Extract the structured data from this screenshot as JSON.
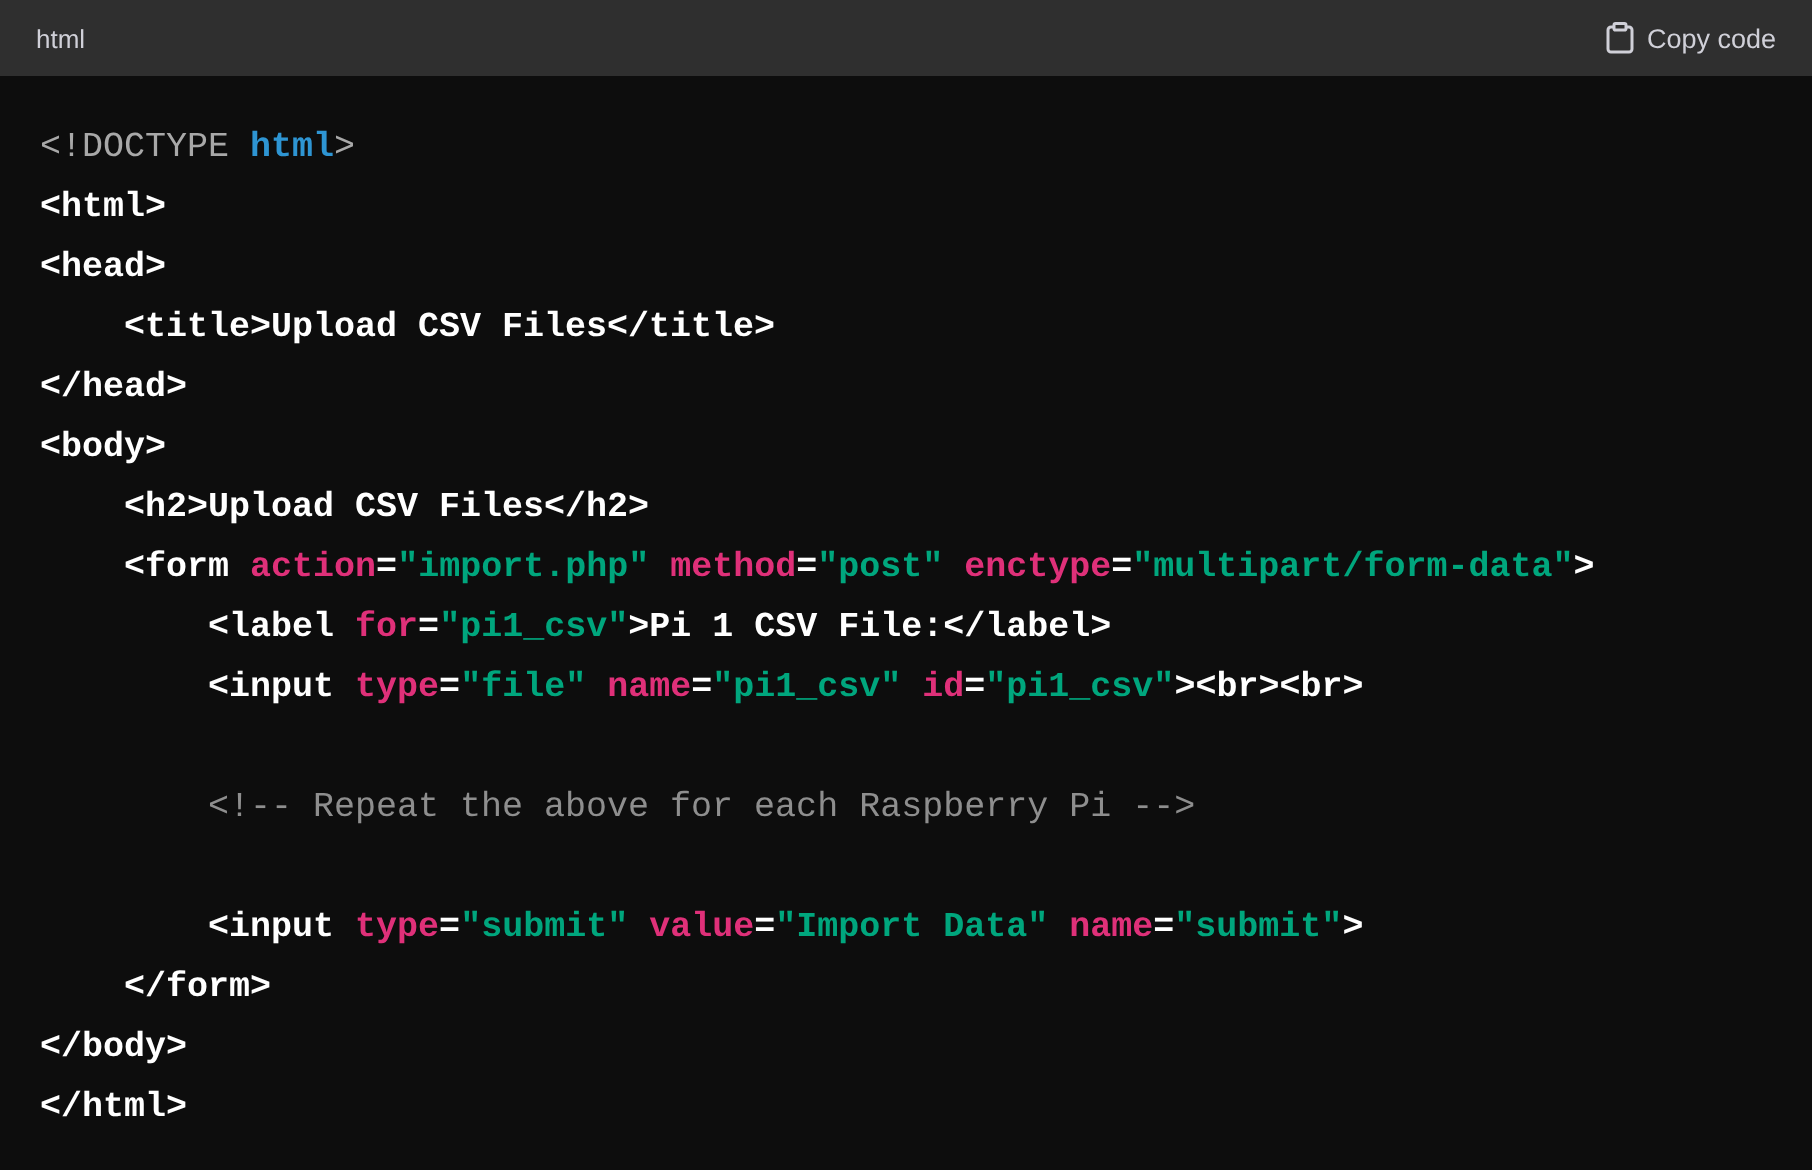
{
  "header": {
    "language": "html",
    "copy_label": "Copy code"
  },
  "lines": [
    {
      "kind": "code",
      "tokens": [
        {
          "kind": "meta",
          "text": "<!DOCTYPE "
        },
        {
          "kind": "keyword",
          "text": "html"
        },
        {
          "kind": "meta",
          "text": ">"
        }
      ]
    },
    {
      "kind": "code",
      "tokens": [
        {
          "kind": "tag",
          "text": "<html>"
        }
      ]
    },
    {
      "kind": "code",
      "tokens": [
        {
          "kind": "tag",
          "text": "<head>"
        }
      ]
    },
    {
      "kind": "code",
      "tokens": [
        {
          "kind": "tag",
          "text": "    <title>Upload CSV Files</title>"
        }
      ]
    },
    {
      "kind": "code",
      "tokens": [
        {
          "kind": "tag",
          "text": "</head>"
        }
      ]
    },
    {
      "kind": "code",
      "tokens": [
        {
          "kind": "tag",
          "text": "<body>"
        }
      ]
    },
    {
      "kind": "code",
      "tokens": [
        {
          "kind": "tag",
          "text": "    <h2>Upload CSV Files</h2>"
        }
      ]
    },
    {
      "kind": "code",
      "tokens": [
        {
          "kind": "tag",
          "text": "    <form "
        },
        {
          "kind": "attr",
          "text": "action"
        },
        {
          "kind": "tag",
          "text": "="
        },
        {
          "kind": "string",
          "text": "\"import.php\" "
        },
        {
          "kind": "attr",
          "text": "method"
        },
        {
          "kind": "tag",
          "text": "="
        },
        {
          "kind": "string",
          "text": "\"post\" "
        },
        {
          "kind": "attr",
          "text": "enctype"
        },
        {
          "kind": "tag",
          "text": "="
        },
        {
          "kind": "string",
          "text": "\"multipart/form-data\""
        },
        {
          "kind": "tag",
          "text": ">"
        }
      ]
    },
    {
      "kind": "code",
      "tokens": [
        {
          "kind": "tag",
          "text": "        <label "
        },
        {
          "kind": "attr",
          "text": "for"
        },
        {
          "kind": "tag",
          "text": "="
        },
        {
          "kind": "string",
          "text": "\"pi1_csv\""
        },
        {
          "kind": "tag",
          "text": ">Pi 1 CSV File:</label>"
        }
      ]
    },
    {
      "kind": "code",
      "tokens": [
        {
          "kind": "tag",
          "text": "        <input "
        },
        {
          "kind": "attr",
          "text": "type"
        },
        {
          "kind": "tag",
          "text": "="
        },
        {
          "kind": "string",
          "text": "\"file\" "
        },
        {
          "kind": "attr",
          "text": "name"
        },
        {
          "kind": "tag",
          "text": "="
        },
        {
          "kind": "string",
          "text": "\"pi1_csv\" "
        },
        {
          "kind": "attr",
          "text": "id"
        },
        {
          "kind": "tag",
          "text": "="
        },
        {
          "kind": "string",
          "text": "\"pi1_csv\""
        },
        {
          "kind": "tag",
          "text": "><br><br>"
        }
      ]
    },
    {
      "kind": "blank"
    },
    {
      "kind": "code",
      "tokens": [
        {
          "kind": "comment",
          "text": "        <!-- Repeat the above for each Raspberry Pi -->"
        }
      ]
    },
    {
      "kind": "blank"
    },
    {
      "kind": "code",
      "tokens": [
        {
          "kind": "tag",
          "text": "        <input "
        },
        {
          "kind": "attr",
          "text": "type"
        },
        {
          "kind": "tag",
          "text": "="
        },
        {
          "kind": "string",
          "text": "\"submit\" "
        },
        {
          "kind": "attr",
          "text": "value"
        },
        {
          "kind": "tag",
          "text": "="
        },
        {
          "kind": "string",
          "text": "\"Import Data\" "
        },
        {
          "kind": "attr",
          "text": "name"
        },
        {
          "kind": "tag",
          "text": "="
        },
        {
          "kind": "string",
          "text": "\"submit\""
        },
        {
          "kind": "tag",
          "text": ">"
        }
      ]
    },
    {
      "kind": "code",
      "tokens": [
        {
          "kind": "tag",
          "text": "    </form>"
        }
      ]
    },
    {
      "kind": "code",
      "tokens": [
        {
          "kind": "tag",
          "text": "</body>"
        }
      ]
    },
    {
      "kind": "code",
      "tokens": [
        {
          "kind": "tag",
          "text": "</html>"
        }
      ]
    }
  ]
}
